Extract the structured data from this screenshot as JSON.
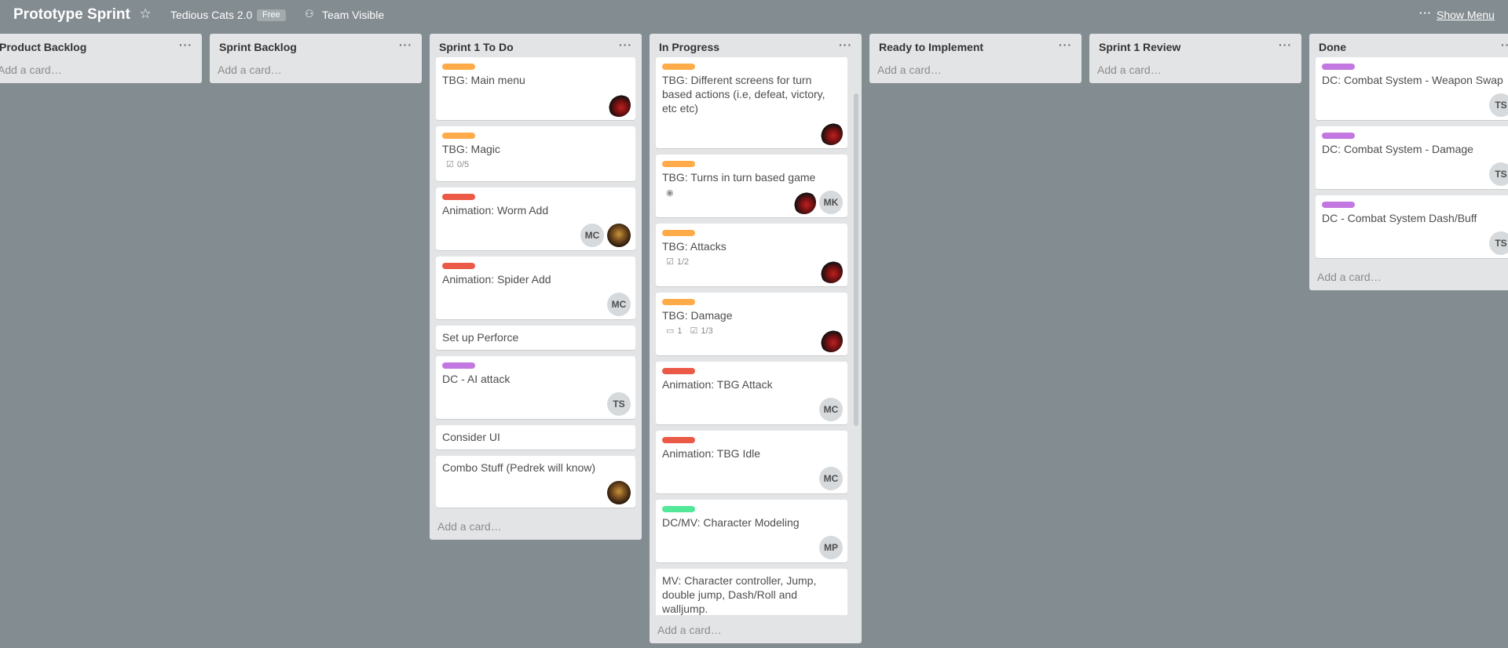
{
  "header": {
    "board_title": "Prototype Sprint",
    "org_name": "Tedious Cats 2.0",
    "org_badge": "Free",
    "visibility": "Team Visible",
    "show_menu": "Show Menu",
    "icons": [
      "star-icon",
      "team-icon",
      "more-icon"
    ]
  },
  "colors": {
    "background": "#838c91",
    "list_bg": "#e2e4e6",
    "label_orange": "#ffab4a",
    "label_red": "#eb5a46",
    "label_purple": "#c377e0",
    "label_green": "#51e898"
  },
  "lists": {
    "product_backlog": {
      "title": "Product Backlog",
      "menu": "···",
      "add": "Add a card…"
    },
    "sprint_backlog": {
      "title": "Sprint Backlog",
      "menu": "···",
      "add": "Add a card…"
    },
    "sprint1_todo": {
      "title": "Sprint 1 To Do",
      "menu": "···",
      "add": "Add a card…",
      "cards": [
        {
          "title": "TBG: Main menu",
          "label": "orange"
        },
        {
          "title": "TBG: Magic",
          "label": "orange",
          "checklist": "0/5"
        },
        {
          "title": "Animation: Worm Add",
          "label": "red",
          "member": "MC"
        },
        {
          "title": "Animation: Spider Add",
          "label": "red",
          "member": "MC"
        },
        {
          "title": "Set up Perforce"
        },
        {
          "title": "DC - AI attack",
          "label": "purple",
          "member": "TS"
        },
        {
          "title": "Consider UI"
        },
        {
          "title": "Combo Stuff (Pedrek will know)"
        }
      ]
    },
    "in_progress": {
      "title": "In Progress",
      "menu": "···",
      "add": "Add a card…",
      "cards": [
        {
          "title": "TBG: Different screens for turn based actions (i.e, defeat, victory, etc etc)",
          "label": "orange"
        },
        {
          "title": "TBG: Turns in turn based game",
          "label": "orange",
          "member": "MK"
        },
        {
          "title": "TBG: Attacks",
          "label": "orange",
          "checklist": "1/2"
        },
        {
          "title": "TBG: Damage",
          "label": "orange",
          "comments": "1",
          "checklist": "1/3"
        },
        {
          "title": "Animation: TBG Attack",
          "label": "red",
          "member": "MC"
        },
        {
          "title": "Animation: TBG Idle",
          "label": "red",
          "member": "MC"
        },
        {
          "title": "DC/MV: Character Modeling",
          "label": "green",
          "member": "MP"
        },
        {
          "title": "MV: Character controller, Jump, double jump, Dash/Roll and walljump."
        }
      ]
    },
    "ready": {
      "title": "Ready to Implement",
      "menu": "···",
      "add": "Add a card…"
    },
    "review": {
      "title": "Sprint 1 Review",
      "menu": "···",
      "add": "Add a card…"
    },
    "done": {
      "title": "Done",
      "menu": "···",
      "add": "Add a card…",
      "cards": [
        {
          "title": "DC: Combat System - Weapon Swap",
          "label": "purple",
          "member": "TS"
        },
        {
          "title": "DC: Combat System - Damage",
          "label": "purple",
          "member": "TS"
        },
        {
          "title": "DC - Combat System Dash/Buff",
          "label": "purple",
          "member": "TS"
        }
      ]
    }
  }
}
